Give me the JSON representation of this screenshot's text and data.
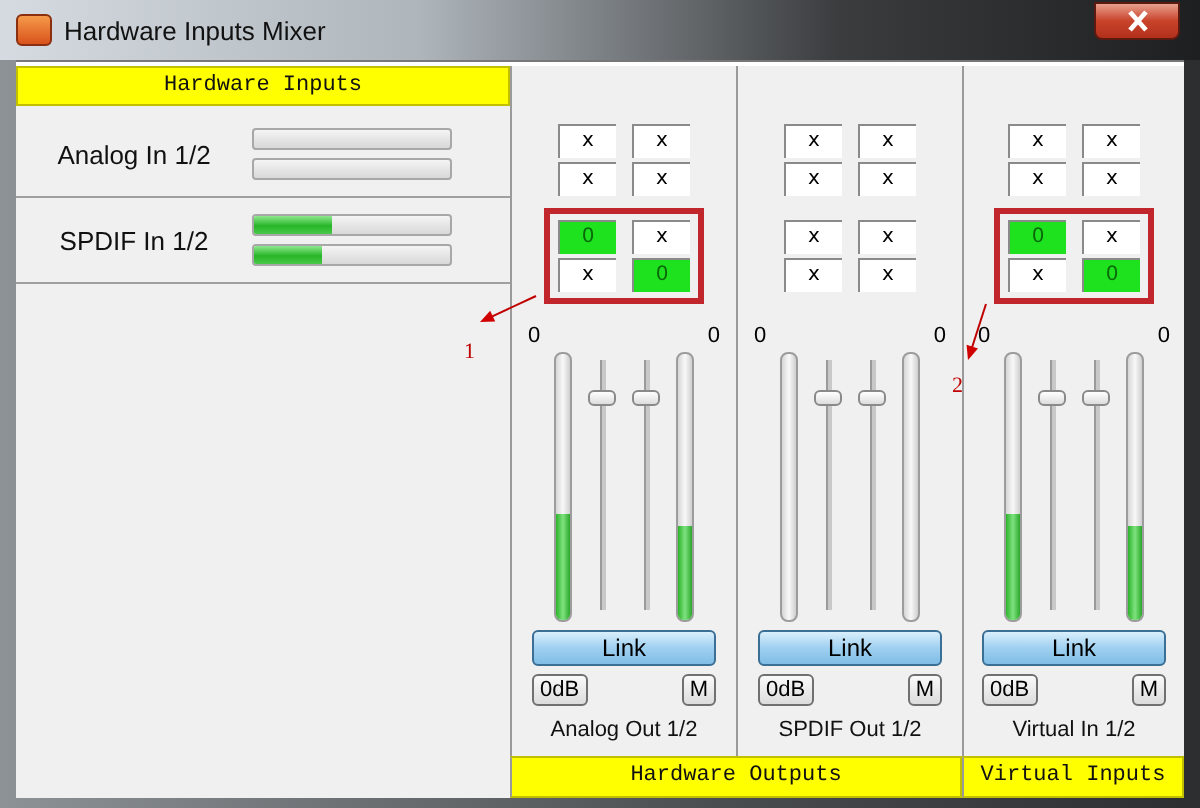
{
  "window": {
    "title": "Hardware Inputs Mixer"
  },
  "inputs": {
    "header": "Hardware Inputs",
    "rows": [
      {
        "name": "Analog In 1/2",
        "meters": [
          {
            "level": 0
          },
          {
            "level": 0
          }
        ]
      },
      {
        "name": "SPDIF In 1/2",
        "meters": [
          {
            "level": 0.4
          },
          {
            "level": 0.35
          }
        ]
      }
    ]
  },
  "outputs": [
    {
      "name": "Analog Out 1/2",
      "groups": [
        {
          "highlighted": false,
          "cells": [
            [
              {
                "text": "x",
                "on": false
              },
              {
                "text": "x",
                "on": false
              }
            ],
            [
              {
                "text": "x",
                "on": false
              },
              {
                "text": "x",
                "on": false
              }
            ]
          ]
        },
        {
          "highlighted": true,
          "cells": [
            [
              {
                "text": "0",
                "on": true
              },
              {
                "text": "x",
                "on": false
              }
            ],
            [
              {
                "text": "x",
                "on": false
              },
              {
                "text": "0",
                "on": true
              }
            ]
          ]
        }
      ],
      "meters": [
        {
          "reading": "0",
          "level": 0.4
        },
        {
          "reading": "0",
          "level": 0.35
        }
      ],
      "faders": [
        {
          "level": 0.85
        },
        {
          "level": 0.85
        }
      ],
      "link": "Link",
      "zero_db": "0dB",
      "mute": "M"
    },
    {
      "name": "SPDIF Out 1/2",
      "groups": [
        {
          "highlighted": false,
          "cells": [
            [
              {
                "text": "x",
                "on": false
              },
              {
                "text": "x",
                "on": false
              }
            ],
            [
              {
                "text": "x",
                "on": false
              },
              {
                "text": "x",
                "on": false
              }
            ]
          ]
        },
        {
          "highlighted": false,
          "cells": [
            [
              {
                "text": "x",
                "on": false
              },
              {
                "text": "x",
                "on": false
              }
            ],
            [
              {
                "text": "x",
                "on": false
              },
              {
                "text": "x",
                "on": false
              }
            ]
          ]
        }
      ],
      "meters": [
        {
          "reading": "0",
          "level": 0
        },
        {
          "reading": "0",
          "level": 0
        }
      ],
      "faders": [
        {
          "level": 0.85
        },
        {
          "level": 0.85
        }
      ],
      "link": "Link",
      "zero_db": "0dB",
      "mute": "M"
    },
    {
      "name": "Virtual In 1/2",
      "groups": [
        {
          "highlighted": false,
          "cells": [
            [
              {
                "text": "x",
                "on": false
              },
              {
                "text": "x",
                "on": false
              }
            ],
            [
              {
                "text": "x",
                "on": false
              },
              {
                "text": "x",
                "on": false
              }
            ]
          ]
        },
        {
          "highlighted": true,
          "cells": [
            [
              {
                "text": "0",
                "on": true
              },
              {
                "text": "x",
                "on": false
              }
            ],
            [
              {
                "text": "x",
                "on": false
              },
              {
                "text": "0",
                "on": true
              }
            ]
          ]
        }
      ],
      "meters": [
        {
          "reading": "0",
          "level": 0.4
        },
        {
          "reading": "0",
          "level": 0.35
        }
      ],
      "faders": [
        {
          "level": 0.85
        },
        {
          "level": 0.85
        }
      ],
      "link": "Link",
      "zero_db": "0dB",
      "mute": "M"
    }
  ],
  "footer": [
    {
      "label": "Hardware Outputs"
    },
    {
      "label": "Virtual Inputs"
    }
  ],
  "annotations": [
    {
      "label": "1"
    },
    {
      "label": "2"
    }
  ]
}
